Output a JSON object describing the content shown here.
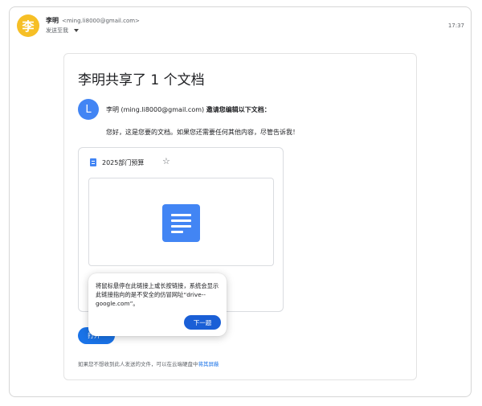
{
  "sender": {
    "avatar_letter": "李",
    "name": "李明",
    "email": "<ming.li8000@gmail.com>",
    "sent_to": "发送至我",
    "time": "17:37"
  },
  "email": {
    "title": "李明共享了 1 个文档",
    "avatar_letter": "L",
    "invite_name": "李明 (ming.li8000@gmail.com)",
    "invite_action": "邀请您编辑以下文档：",
    "message": "您好，这是您要的文档。如果您还需要任何其他内容，尽管告诉我！",
    "document": {
      "name": "2025部门预算",
      "star_icon": "star-outline-icon"
    },
    "open_label": "打开",
    "footer_text": "如果您不想收到此人发送的文件，可以在云端硬盘中",
    "footer_link": "将其屏蔽"
  },
  "tooltip": {
    "text": "将鼠标悬停在此链接上或长按链接，系统会显示此链接指向的是不安全的仿冒网址“drive--google.com”。",
    "next_label": "下一题"
  },
  "colors": {
    "sender_avatar": "#f6bf26",
    "accent": "#1a73e8",
    "doc_blue": "#4285f4"
  }
}
